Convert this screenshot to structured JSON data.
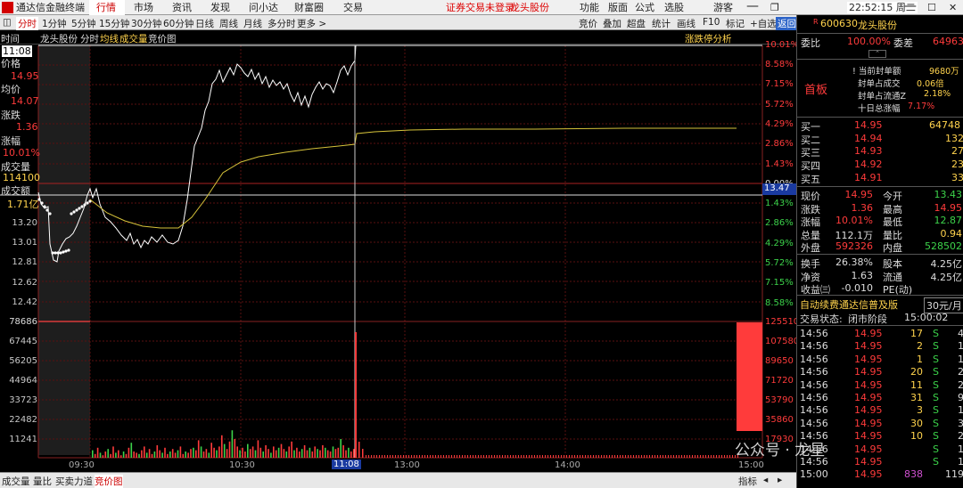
{
  "app": {
    "title": "通达信金融终端",
    "menu": [
      "行情",
      "市场",
      "资讯",
      "发现",
      "问小达",
      "财富圈",
      "交易"
    ],
    "notice": "证券交易未登录",
    "stock_link": "龙头股份",
    "right_menu": [
      "功能",
      "版面",
      "公式",
      "选股",
      "游客"
    ],
    "clock": "22:52:15 周二"
  },
  "toolbar": {
    "left": [
      "分时",
      "1分钟",
      "5分钟",
      "15分钟",
      "30分钟",
      "60分钟",
      "日线",
      "周线",
      "月线",
      "多分时",
      "更多 >"
    ],
    "right": [
      "竞价",
      "叠加",
      "超盘",
      "统计",
      "画线",
      "F10",
      "标记",
      "+自选",
      "返回"
    ]
  },
  "chart": {
    "header": [
      "时间",
      "龙头股份",
      "分时",
      "均线",
      "成交量",
      "竞价图"
    ],
    "analysis_button": "涨跌停分析",
    "info": {
      "price_label": "价格",
      "price": "14.95",
      "avg_label": "均价",
      "avg": "14.07",
      "chg_label": "涨跌",
      "chg": "1.36",
      "pct_label": "涨幅",
      "pct": "10.01%",
      "vol_label": "成交量",
      "vol": "114100",
      "amt_label": "成交额",
      "amt": "1.71亿"
    },
    "cursor_time": "11:08",
    "price_axis_left": [
      "13.20",
      "13.01",
      "12.81",
      "12.62",
      "12.42"
    ],
    "price_axis_right": [
      "10.01%",
      "8.58%",
      "7.15%",
      "5.72%",
      "4.29%",
      "2.86%",
      "1.43%",
      "0.00%",
      "1.43%",
      "2.86%",
      "4.29%",
      "5.72%",
      "7.15%",
      "8.58%"
    ],
    "price_tag": "13.47",
    "vol_axis_left": [
      "78686",
      "67445",
      "56205",
      "44964",
      "33723",
      "22482",
      "11241"
    ],
    "vol_axis_right": [
      "125510",
      "107580",
      "89650",
      "71720",
      "53790",
      "35860",
      "17930"
    ],
    "time_axis": [
      "09:30",
      "10:30",
      "11:08",
      "13:00",
      "14:00",
      "15:00"
    ]
  },
  "bottombar": {
    "tabs": [
      "成交量",
      "量比",
      "买卖力道",
      "竞价图"
    ],
    "right": "指标"
  },
  "panel": {
    "code": "600630",
    "name": "龙头股份",
    "wb_label": "委比",
    "wb": "100.00%",
    "wc_label": "委差",
    "wc": "64963",
    "board": "首板",
    "stats": [
      {
        "label": "! 当前封单额",
        "value": "9680万"
      },
      {
        "label": "封单占成交",
        "value": "0.06倍"
      },
      {
        "label": "封单占流通Z",
        "value": "2.18%"
      },
      {
        "label": "十日总涨幅",
        "value": "7.17%"
      }
    ],
    "sells": [],
    "buys": [
      {
        "label": "买一",
        "price": "14.95",
        "vol": "64748"
      },
      {
        "label": "买二",
        "price": "14.94",
        "vol": "132"
      },
      {
        "label": "买三",
        "price": "14.93",
        "vol": "27"
      },
      {
        "label": "买四",
        "price": "14.92",
        "vol": "23"
      },
      {
        "label": "买五",
        "price": "14.91",
        "vol": "33"
      }
    ],
    "quote": [
      {
        "l1": "现价",
        "v1": "14.95",
        "l2": "今开",
        "v2": "13.43",
        "c1": "red",
        "c2": "green"
      },
      {
        "l1": "涨跌",
        "v1": "1.36",
        "l2": "最高",
        "v2": "14.95",
        "c1": "red",
        "c2": "red"
      },
      {
        "l1": "涨幅",
        "v1": "10.01%",
        "l2": "最低",
        "v2": "12.87",
        "c1": "red",
        "c2": "green"
      },
      {
        "l1": "总量",
        "v1": "112.1万",
        "l2": "量比",
        "v2": "0.94",
        "c1": "white",
        "c2": "yellow"
      },
      {
        "l1": "外盘",
        "v1": "592326",
        "l2": "内盘",
        "v2": "528502",
        "c1": "red",
        "c2": "green"
      }
    ],
    "quote2": [
      {
        "l1": "换手",
        "v1": "26.38%",
        "l2": "股本",
        "v2": "4.25亿"
      },
      {
        "l1": "净资",
        "v1": "1.63",
        "l2": "流通",
        "v2": "4.25亿"
      },
      {
        "l1": "收益㈢",
        "v1": "-0.010",
        "l2": "PE(动)",
        "v2": ""
      }
    ],
    "promo": "自动续费通达信普及版",
    "promo_price": "30元/月",
    "status_label": "交易状态:",
    "status": "闭市阶段",
    "status_time": "15:00:02",
    "ticks": [
      {
        "t": "14:56",
        "p": "14.95",
        "v": "17",
        "s": "S",
        "n": "4"
      },
      {
        "t": "14:56",
        "p": "14.95",
        "v": "2",
        "s": "S",
        "n": "1"
      },
      {
        "t": "14:56",
        "p": "14.95",
        "v": "1",
        "s": "S",
        "n": "1"
      },
      {
        "t": "14:56",
        "p": "14.95",
        "v": "20",
        "s": "S",
        "n": "2"
      },
      {
        "t": "14:56",
        "p": "14.95",
        "v": "11",
        "s": "S",
        "n": "2"
      },
      {
        "t": "14:56",
        "p": "14.95",
        "v": "31",
        "s": "S",
        "n": "9"
      },
      {
        "t": "14:56",
        "p": "14.95",
        "v": "3",
        "s": "S",
        "n": "1"
      },
      {
        "t": "14:56",
        "p": "14.95",
        "v": "30",
        "s": "S",
        "n": "3"
      },
      {
        "t": "14:56",
        "p": "14.95",
        "v": "10",
        "s": "S",
        "n": "2"
      },
      {
        "t": "14:56",
        "p": "14.95",
        "v": "",
        "s": "S",
        "n": "1"
      },
      {
        "t": "14:56",
        "p": "14.95",
        "v": "",
        "s": "S",
        "n": "1"
      },
      {
        "t": "15:00",
        "p": "14.95",
        "v": "838",
        "s": "",
        "n": "119"
      }
    ],
    "watermark": "公众号 · 龙星"
  },
  "colors": {
    "up": "#ff3b3b",
    "down": "#3cd24a",
    "avg": "#d6c33a",
    "line": "#ffffff",
    "grid": "#7a1a1a"
  }
}
